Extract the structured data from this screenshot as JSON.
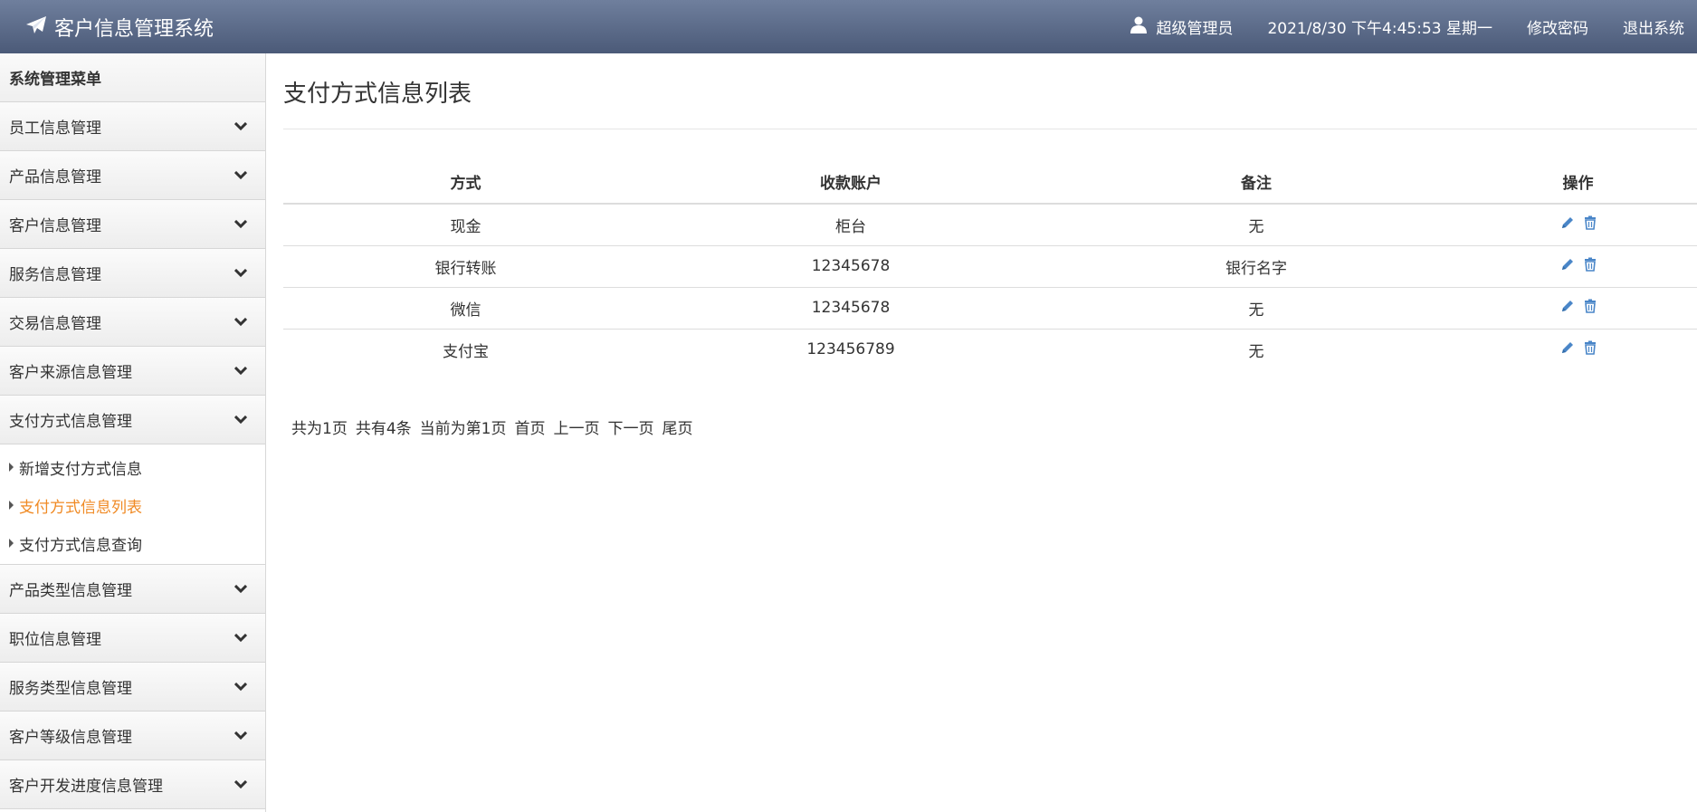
{
  "header": {
    "title": "客户信息管理系统",
    "user": "超级管理员",
    "datetime": "2021/8/30 下午4:45:53 星期一",
    "change_password": "修改密码",
    "logout": "退出系统",
    "logo_icon": "paper-plane-icon",
    "user_icon": "user-icon"
  },
  "sidebar": {
    "header": "系统管理菜单",
    "items": [
      {
        "label": "员工信息管理"
      },
      {
        "label": "产品信息管理"
      },
      {
        "label": "客户信息管理"
      },
      {
        "label": "服务信息管理"
      },
      {
        "label": "交易信息管理"
      },
      {
        "label": "客户来源信息管理"
      },
      {
        "label": "支付方式信息管理"
      },
      {
        "label": "产品类型信息管理"
      },
      {
        "label": "职位信息管理"
      },
      {
        "label": "服务类型信息管理"
      },
      {
        "label": "客户等级信息管理"
      },
      {
        "label": "客户开发进度信息管理"
      }
    ],
    "submenu": [
      {
        "label": "新增支付方式信息"
      },
      {
        "label": "支付方式信息列表"
      },
      {
        "label": "支付方式信息查询"
      }
    ],
    "active_color": "#f08a24"
  },
  "main": {
    "title": "支付方式信息列表",
    "columns": [
      "方式",
      "收款账户",
      "备注",
      "操作"
    ],
    "rows": [
      {
        "method": "现金",
        "account": "柜台",
        "note": "无"
      },
      {
        "method": "银行转账",
        "account": "12345678",
        "note": "银行名字"
      },
      {
        "method": "微信",
        "account": "12345678",
        "note": "无"
      },
      {
        "method": "支付宝",
        "account": "123456789",
        "note": "无"
      }
    ],
    "action_icons": [
      "pencil-icon",
      "trash-icon"
    ],
    "action_color": "#4a86c8"
  },
  "pager": {
    "total_pages": "共为1页",
    "total_records": "共有4条",
    "current": "当前为第1页",
    "first": "首页",
    "prev": "上一页",
    "next": "下一页",
    "last": "尾页"
  }
}
